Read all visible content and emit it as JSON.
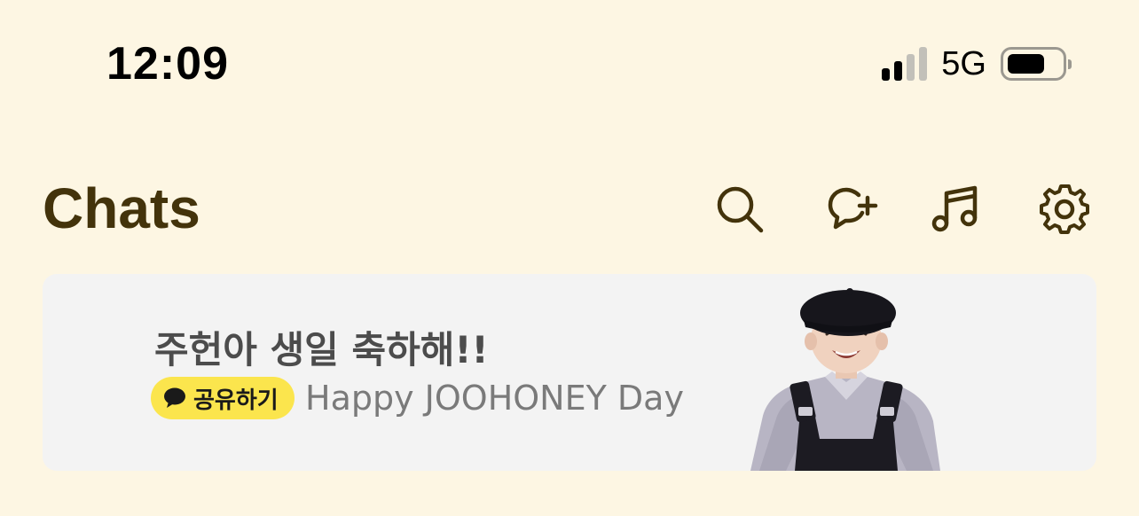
{
  "status_bar": {
    "time": "12:09",
    "network": "5G",
    "signal_bars_active": 2,
    "signal_bars_total": 4,
    "battery_level": 0.7,
    "signal_color_active": "#000000",
    "signal_color_inactive": "#c2c0b9"
  },
  "header": {
    "title": "Chats",
    "title_color": "#43330b",
    "icons": [
      "search-icon",
      "new-chat-icon",
      "music-icon",
      "settings-icon"
    ]
  },
  "banner": {
    "title": "주헌아 생일 축하해!!",
    "share_label": "공유하기",
    "subtitle": "Happy JOOHONEY Day",
    "share_color": "#fbe54d",
    "background": "#f3f3f3"
  },
  "colors": {
    "page_background": "#fdf6e3",
    "icon_stroke": "#43330b"
  }
}
